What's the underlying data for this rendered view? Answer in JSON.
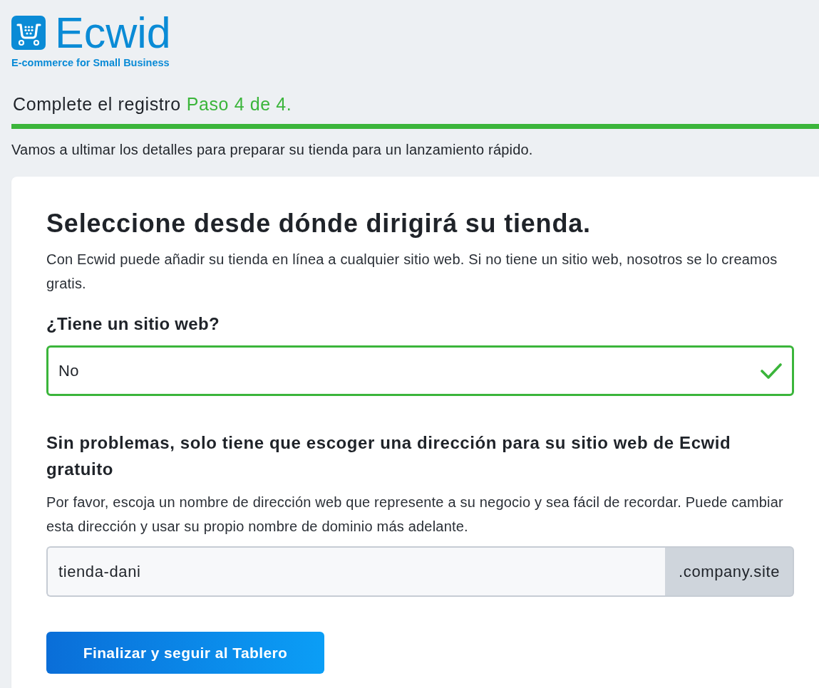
{
  "logo": {
    "name": "Ecwid",
    "tagline": "E-commerce for Small Business"
  },
  "progress": {
    "title": "Complete el registro",
    "step": "Paso 4 de 4.",
    "level": 1
  },
  "intro": "Vamos a ultimar los detalles para preparar su tienda para un lanzamiento rápido.",
  "card": {
    "heading": "Seleccione desde dónde dirigirá su tienda.",
    "description": "Con Ecwid puede añadir su tienda en línea a cualquier sitio web. Si no tiene un sitio web, nosotros se lo creamos gratis.",
    "website_question": {
      "label": "¿Tiene un sitio web?",
      "value": "No",
      "valid": true
    },
    "address": {
      "heading": "Sin problemas, solo tiene que escoger una dirección para su sitio web de Ecwid gratuito",
      "description": "Por favor, escoja un nombre de dirección web que represente a su negocio y sea fácil de recordar. Puede cambiar esta dirección y usar su propio nombre de dominio más adelante.",
      "value": "tienda-dani",
      "suffix": ".company.site"
    },
    "submit_button": "Finalizar y seguir al Tablero"
  }
}
